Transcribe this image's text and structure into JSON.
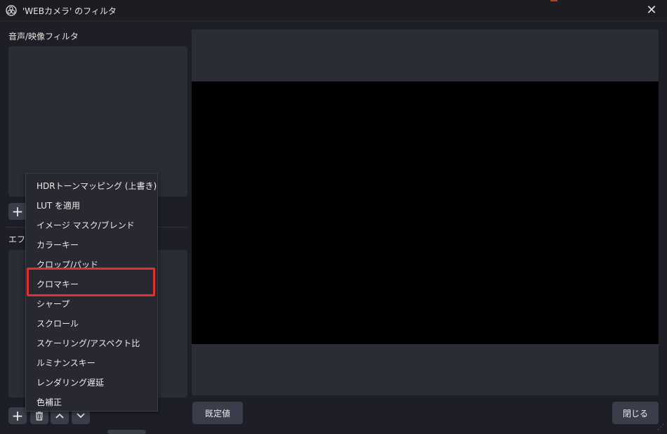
{
  "window": {
    "title": "'WEBカメラ' のフィルタ",
    "close_glyph": "✕",
    "icon": "obs-logo-icon"
  },
  "audio_video_filters": {
    "label": "音声/映像フィルタ",
    "add_glyph": "+"
  },
  "effect_filters": {
    "label": "エフェ",
    "add_glyph": "+",
    "toolbar_icons": [
      "trash-icon",
      "move-up-icon",
      "move-down-icon"
    ]
  },
  "menu": {
    "items": [
      {
        "label": "HDRトーンマッピング (上書き)"
      },
      {
        "label": "LUT を適用"
      },
      {
        "label": "イメージ マスク/ブレンド"
      },
      {
        "label": "カラーキー"
      },
      {
        "label": "クロップ/パッド"
      },
      {
        "label": "クロマキー",
        "highlighted": true
      },
      {
        "label": "シャープ"
      },
      {
        "label": "スクロール"
      },
      {
        "label": "スケーリング/アスペクト比"
      },
      {
        "label": "ルミナンスキー"
      },
      {
        "label": "レンダリング遅延"
      },
      {
        "label": "色補正"
      }
    ]
  },
  "buttons": {
    "defaults_label": "既定値",
    "close_label": "閉じる"
  },
  "colors": {
    "highlight": "#e03030",
    "preview": "#000000",
    "panel": "#2a2c36"
  }
}
